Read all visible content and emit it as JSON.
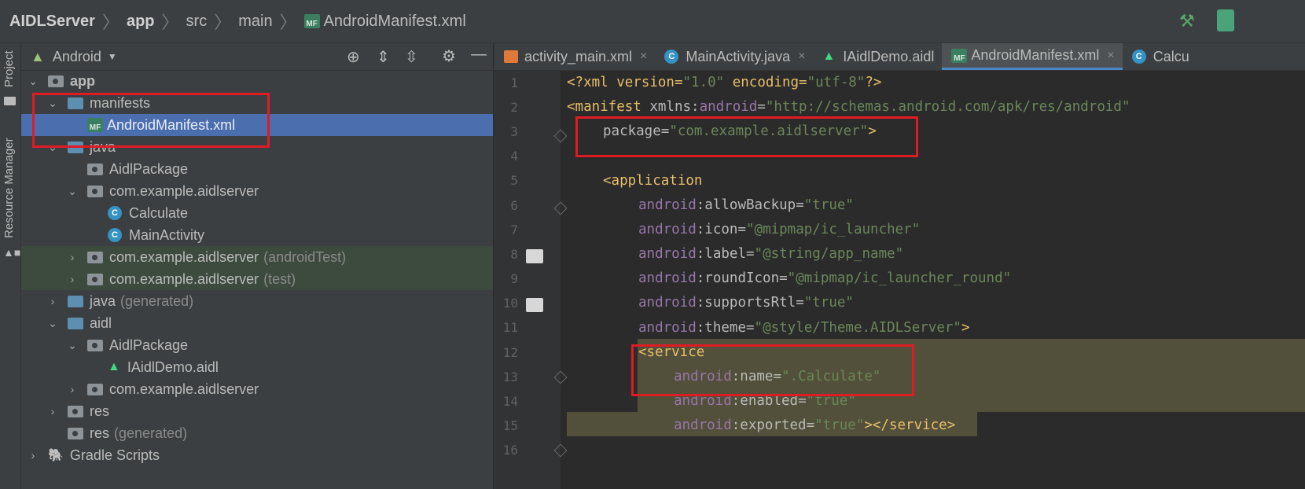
{
  "breadcrumb": {
    "items": [
      "AIDLServer",
      "app",
      "src",
      "main",
      "AndroidManifest.xml"
    ]
  },
  "side_strip": {
    "project_label": "Project",
    "resource_manager_label": "Resource Manager"
  },
  "project_panel": {
    "view_selector": "Android",
    "tree": [
      {
        "label": "app",
        "suffix": ""
      },
      {
        "label": "manifests",
        "suffix": ""
      },
      {
        "label": "AndroidManifest.xml",
        "suffix": ""
      },
      {
        "label": "java",
        "suffix": ""
      },
      {
        "label": "AidlPackage",
        "suffix": ""
      },
      {
        "label": "com.example.aidlserver",
        "suffix": ""
      },
      {
        "label": "Calculate",
        "suffix": ""
      },
      {
        "label": "MainActivity",
        "suffix": ""
      },
      {
        "label": "com.example.aidlserver",
        "suffix": "(androidTest)"
      },
      {
        "label": "com.example.aidlserver",
        "suffix": "(test)"
      },
      {
        "label": "java",
        "suffix": "(generated)"
      },
      {
        "label": "aidl",
        "suffix": ""
      },
      {
        "label": "AidlPackage",
        "suffix": ""
      },
      {
        "label": "IAidlDemo.aidl",
        "suffix": ""
      },
      {
        "label": "com.example.aidlserver",
        "suffix": ""
      },
      {
        "label": "res",
        "suffix": ""
      },
      {
        "label": "res",
        "suffix": "(generated)"
      },
      {
        "label": "Gradle Scripts",
        "suffix": ""
      }
    ]
  },
  "editor": {
    "tabs": [
      "activity_main.xml",
      "MainActivity.java",
      "IAidlDemo.aidl",
      "AndroidManifest.xml",
      "Calcu"
    ],
    "line_numbers": [
      "1",
      "2",
      "3",
      "4",
      "5",
      "6",
      "7",
      "8",
      "9",
      "10",
      "11",
      "12",
      "13",
      "14",
      "15",
      "16"
    ],
    "code": {
      "l1_a": "<?xml version=",
      "l1_b": "\"1.0\"",
      "l1_c": " encoding=",
      "l1_d": "\"utf-8\"",
      "l1_e": "?>",
      "l2_a": "<manifest ",
      "l2_b": "xmlns:",
      "l2_c": "android",
      "l2_d": "=",
      "l2_e": "\"http://schemas.android.com/apk/res/android\"",
      "l3_a": "package",
      "l3_b": "=",
      "l3_c": "\"com.example.aidlserver\"",
      "l3_d": ">",
      "l5": "<application",
      "ns": "android",
      "l6_attr": ":allowBackup",
      "l6_val": "\"true\"",
      "l7_attr": ":icon",
      "l7_val": "\"@mipmap/ic_launcher\"",
      "l8_attr": ":label",
      "l8_val": "\"@string/app_name\"",
      "l9_attr": ":roundIcon",
      "l9_val": "\"@mipmap/ic_launcher_round\"",
      "l10_attr": ":supportsRtl",
      "l10_val": "\"true\"",
      "l11_attr": ":theme",
      "l11_val": "\"@style/Theme.AIDLServer\"",
      "l11_end": ">",
      "l12": "<service",
      "l13_attr": ":name",
      "l13_val": "\".Calculate\"",
      "l14_attr": ":enabled",
      "l14_val": "\"true\"",
      "l15_attr": ":exported",
      "l15_val": "\"true\"",
      "l15_end": "></service>"
    }
  },
  "colors": {
    "highlight": "#e01b24",
    "selection": "#4b6eaf",
    "accent_tab": "#4a88c7"
  }
}
